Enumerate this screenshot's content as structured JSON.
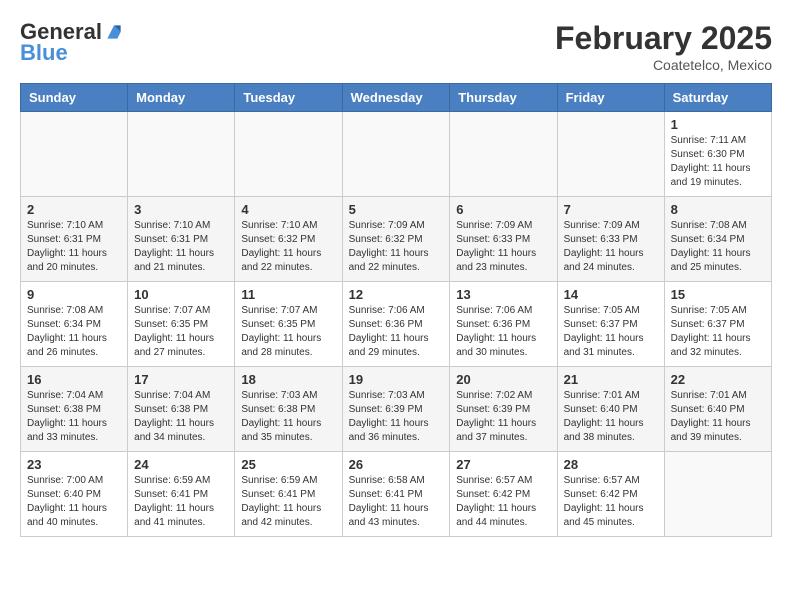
{
  "header": {
    "logo_line1": "General",
    "logo_line2": "Blue",
    "month": "February 2025",
    "location": "Coatetelco, Mexico"
  },
  "days_of_week": [
    "Sunday",
    "Monday",
    "Tuesday",
    "Wednesday",
    "Thursday",
    "Friday",
    "Saturday"
  ],
  "weeks": [
    [
      {
        "num": "",
        "info": ""
      },
      {
        "num": "",
        "info": ""
      },
      {
        "num": "",
        "info": ""
      },
      {
        "num": "",
        "info": ""
      },
      {
        "num": "",
        "info": ""
      },
      {
        "num": "",
        "info": ""
      },
      {
        "num": "1",
        "info": "Sunrise: 7:11 AM\nSunset: 6:30 PM\nDaylight: 11 hours\nand 19 minutes."
      }
    ],
    [
      {
        "num": "2",
        "info": "Sunrise: 7:10 AM\nSunset: 6:31 PM\nDaylight: 11 hours\nand 20 minutes."
      },
      {
        "num": "3",
        "info": "Sunrise: 7:10 AM\nSunset: 6:31 PM\nDaylight: 11 hours\nand 21 minutes."
      },
      {
        "num": "4",
        "info": "Sunrise: 7:10 AM\nSunset: 6:32 PM\nDaylight: 11 hours\nand 22 minutes."
      },
      {
        "num": "5",
        "info": "Sunrise: 7:09 AM\nSunset: 6:32 PM\nDaylight: 11 hours\nand 22 minutes."
      },
      {
        "num": "6",
        "info": "Sunrise: 7:09 AM\nSunset: 6:33 PM\nDaylight: 11 hours\nand 23 minutes."
      },
      {
        "num": "7",
        "info": "Sunrise: 7:09 AM\nSunset: 6:33 PM\nDaylight: 11 hours\nand 24 minutes."
      },
      {
        "num": "8",
        "info": "Sunrise: 7:08 AM\nSunset: 6:34 PM\nDaylight: 11 hours\nand 25 minutes."
      }
    ],
    [
      {
        "num": "9",
        "info": "Sunrise: 7:08 AM\nSunset: 6:34 PM\nDaylight: 11 hours\nand 26 minutes."
      },
      {
        "num": "10",
        "info": "Sunrise: 7:07 AM\nSunset: 6:35 PM\nDaylight: 11 hours\nand 27 minutes."
      },
      {
        "num": "11",
        "info": "Sunrise: 7:07 AM\nSunset: 6:35 PM\nDaylight: 11 hours\nand 28 minutes."
      },
      {
        "num": "12",
        "info": "Sunrise: 7:06 AM\nSunset: 6:36 PM\nDaylight: 11 hours\nand 29 minutes."
      },
      {
        "num": "13",
        "info": "Sunrise: 7:06 AM\nSunset: 6:36 PM\nDaylight: 11 hours\nand 30 minutes."
      },
      {
        "num": "14",
        "info": "Sunrise: 7:05 AM\nSunset: 6:37 PM\nDaylight: 11 hours\nand 31 minutes."
      },
      {
        "num": "15",
        "info": "Sunrise: 7:05 AM\nSunset: 6:37 PM\nDaylight: 11 hours\nand 32 minutes."
      }
    ],
    [
      {
        "num": "16",
        "info": "Sunrise: 7:04 AM\nSunset: 6:38 PM\nDaylight: 11 hours\nand 33 minutes."
      },
      {
        "num": "17",
        "info": "Sunrise: 7:04 AM\nSunset: 6:38 PM\nDaylight: 11 hours\nand 34 minutes."
      },
      {
        "num": "18",
        "info": "Sunrise: 7:03 AM\nSunset: 6:38 PM\nDaylight: 11 hours\nand 35 minutes."
      },
      {
        "num": "19",
        "info": "Sunrise: 7:03 AM\nSunset: 6:39 PM\nDaylight: 11 hours\nand 36 minutes."
      },
      {
        "num": "20",
        "info": "Sunrise: 7:02 AM\nSunset: 6:39 PM\nDaylight: 11 hours\nand 37 minutes."
      },
      {
        "num": "21",
        "info": "Sunrise: 7:01 AM\nSunset: 6:40 PM\nDaylight: 11 hours\nand 38 minutes."
      },
      {
        "num": "22",
        "info": "Sunrise: 7:01 AM\nSunset: 6:40 PM\nDaylight: 11 hours\nand 39 minutes."
      }
    ],
    [
      {
        "num": "23",
        "info": "Sunrise: 7:00 AM\nSunset: 6:40 PM\nDaylight: 11 hours\nand 40 minutes."
      },
      {
        "num": "24",
        "info": "Sunrise: 6:59 AM\nSunset: 6:41 PM\nDaylight: 11 hours\nand 41 minutes."
      },
      {
        "num": "25",
        "info": "Sunrise: 6:59 AM\nSunset: 6:41 PM\nDaylight: 11 hours\nand 42 minutes."
      },
      {
        "num": "26",
        "info": "Sunrise: 6:58 AM\nSunset: 6:41 PM\nDaylight: 11 hours\nand 43 minutes."
      },
      {
        "num": "27",
        "info": "Sunrise: 6:57 AM\nSunset: 6:42 PM\nDaylight: 11 hours\nand 44 minutes."
      },
      {
        "num": "28",
        "info": "Sunrise: 6:57 AM\nSunset: 6:42 PM\nDaylight: 11 hours\nand 45 minutes."
      },
      {
        "num": "",
        "info": ""
      }
    ]
  ]
}
